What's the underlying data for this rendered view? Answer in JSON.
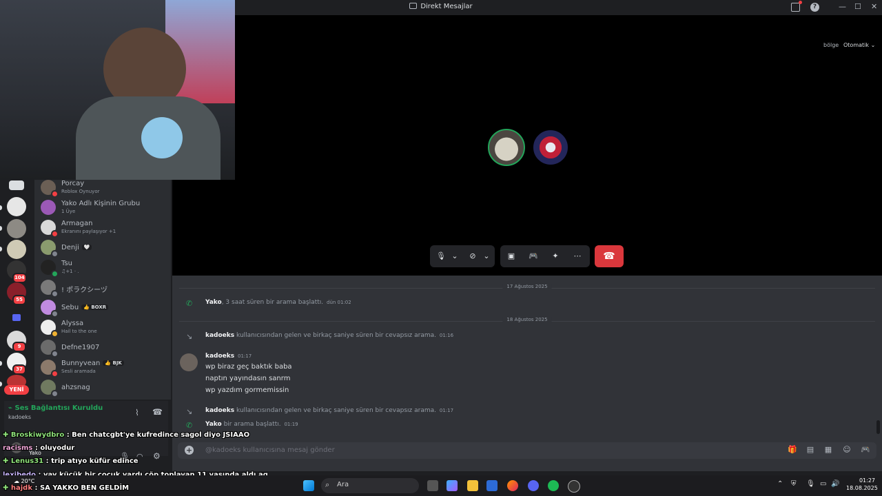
{
  "window": {
    "title": "Direkt Mesajlar"
  },
  "call": {
    "region_label": "bölge",
    "region_value": "Otomatik"
  },
  "dm_list": [
    {
      "name": "Porcay",
      "sub": "Roblox Oynuyor",
      "tag": "",
      "status": "#f23f43",
      "avatar": "#6b5f55"
    },
    {
      "name": "Yako Adlı Kişinin Grubu",
      "sub": "1 Üye",
      "tag": "",
      "status": "",
      "avatar": "#9b59b6"
    },
    {
      "name": "Armagan",
      "sub": "Ekranını paylaşıyor +1",
      "tag": "",
      "status": "#f23f43",
      "avatar": "#d9d9d9"
    },
    {
      "name": "Denji",
      "sub": "",
      "tag": "🤍",
      "status": "#80848e",
      "avatar": "#8a9b6e"
    },
    {
      "name": "Tsu",
      "sub": "♫+1 · .",
      "tag": "",
      "status": "#23a55a",
      "avatar": "#222"
    },
    {
      "name": "! ポラクシーヅ",
      "sub": "",
      "tag": "",
      "status": "#80848e",
      "avatar": "#7a7a7a"
    },
    {
      "name": "Sebu",
      "sub": "",
      "tag": "👍 BOXR",
      "status": "#80848e",
      "avatar": "#c08be0"
    },
    {
      "name": "Alyssa",
      "sub": "Hail to the one",
      "tag": "",
      "status": "#f0b232",
      "avatar": "#eeeeee"
    },
    {
      "name": "Defne1907",
      "sub": "",
      "tag": "",
      "status": "#80848e",
      "avatar": "#6b6b6b"
    },
    {
      "name": "Bunnyvean",
      "sub": "Sesli aramada",
      "tag": "👍 BJK",
      "status": "#f23f43",
      "avatar": "#8c7a6b"
    },
    {
      "name": "ahzsnag",
      "sub": "",
      "tag": "",
      "status": "#80848e",
      "avatar": "#707a60"
    }
  ],
  "rail": {
    "badges": [
      "104",
      "55",
      "9",
      "37"
    ],
    "new_label": "YENİ"
  },
  "voice_panel": {
    "status": "Ses Bağlantısı Kuruldu",
    "channel": "kadoeks"
  },
  "user_panel": {
    "name": "Yako"
  },
  "chat": {
    "dates": [
      "17 Ağustos 2025",
      "18 Ağustos 2025"
    ],
    "sys1": {
      "user": "Yako",
      "text": ", 3 saat süren bir arama başlattı.",
      "time": "dün 01:02"
    },
    "sys2": {
      "user": "kadoeks",
      "text": "kullanıcısından gelen ve birkaç saniye süren bir cevapsız arama.",
      "time": "01:16"
    },
    "message": {
      "user": "kadoeks",
      "time": "01:17",
      "lines": [
        "wp biraz geç baktık baba",
        "naptın yayındasın sanrm",
        "wp yazdım gormemissin"
      ]
    },
    "sys3": {
      "user": "kadoeks",
      "text": "kullanıcısından gelen ve birkaç saniye süren bir cevapsız arama.",
      "time": "01:17"
    },
    "sys4": {
      "user": "Yako",
      "text": "bir arama başlattı.",
      "time": "01:19"
    },
    "composer_placeholder": "@kadoeks kullanıcısına mesaj gönder"
  },
  "overlay_chat": [
    {
      "user": "Broskiwydbro",
      "text": ": Ben chatcgbt'ye kufredince sagol diyo JSIAAO"
    },
    {
      "user": "racisms",
      "text": ": oluyodur"
    },
    {
      "user": "Lenus31",
      "text": ": trip atıyo küfür edince"
    },
    {
      "user": "lexibedo",
      "text": ": vay küçük bir çocuk vardı çöp toplayan 11 yaşında aldı aq"
    },
    {
      "user": "hajdk",
      "text": ": SA YAKKO BEN GELDİM"
    }
  ],
  "taskbar": {
    "search": "Ara",
    "time": "01:27",
    "date": "18.08.2025",
    "weather": "20°C"
  },
  "colors": {
    "accent": "#5865f2",
    "online": "#23a55a",
    "danger": "#da373c"
  }
}
